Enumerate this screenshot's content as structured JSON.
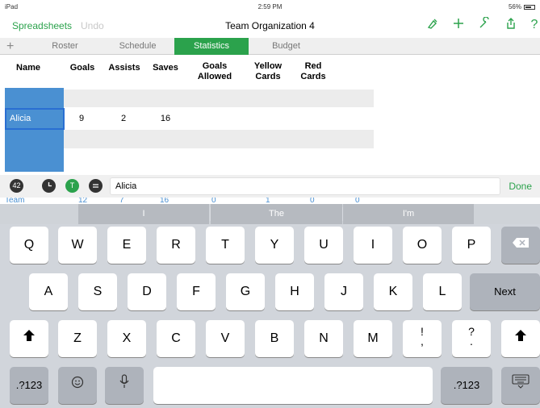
{
  "status_bar": {
    "device": "iPad",
    "time": "2:59 PM",
    "battery": "56%"
  },
  "toolbar": {
    "spreadsheets": "Spreadsheets",
    "undo": "Undo",
    "title": "Team Organization 4",
    "icons": [
      "brush-icon",
      "plus-icon",
      "wrench-icon",
      "share-icon",
      "help-icon"
    ],
    "help_label": "?"
  },
  "tabs": {
    "add": "+",
    "items": [
      {
        "label": "Roster"
      },
      {
        "label": "Schedule"
      },
      {
        "label": "Statistics",
        "active": true
      },
      {
        "label": "Budget"
      }
    ]
  },
  "table": {
    "headers": [
      "Name",
      "Goals",
      "Assists",
      "Saves",
      "Goals\nAllowed",
      "Yellow\nCards",
      "Red\nCards"
    ],
    "selected_row": {
      "name": "Alicia",
      "goals": "9",
      "assists": "2",
      "saves": "16"
    }
  },
  "formula_bar": {
    "icons": [
      "42",
      "clock",
      "T",
      "equals"
    ],
    "value": "Alicia",
    "done": "Done"
  },
  "team_row": {
    "label": "Team",
    "values": [
      "12",
      "7",
      "16",
      "0",
      "1",
      "0",
      "0"
    ]
  },
  "keyboard": {
    "predictions": [
      "I",
      "The",
      "I'm"
    ],
    "row1": [
      "Q",
      "W",
      "E",
      "R",
      "T",
      "Y",
      "U",
      "I",
      "O",
      "P"
    ],
    "row2": [
      "A",
      "S",
      "D",
      "F",
      "G",
      "H",
      "J",
      "K",
      "L"
    ],
    "row3": [
      "Z",
      "X",
      "C",
      "V",
      "B",
      "N",
      "M"
    ],
    "punct1_top": "!",
    "punct1_bottom": ",",
    "punct2_top": "?",
    "punct2_bottom": ".",
    "next": "Next",
    "numbers": ".?123",
    "accent_color": "#2ba24c"
  }
}
